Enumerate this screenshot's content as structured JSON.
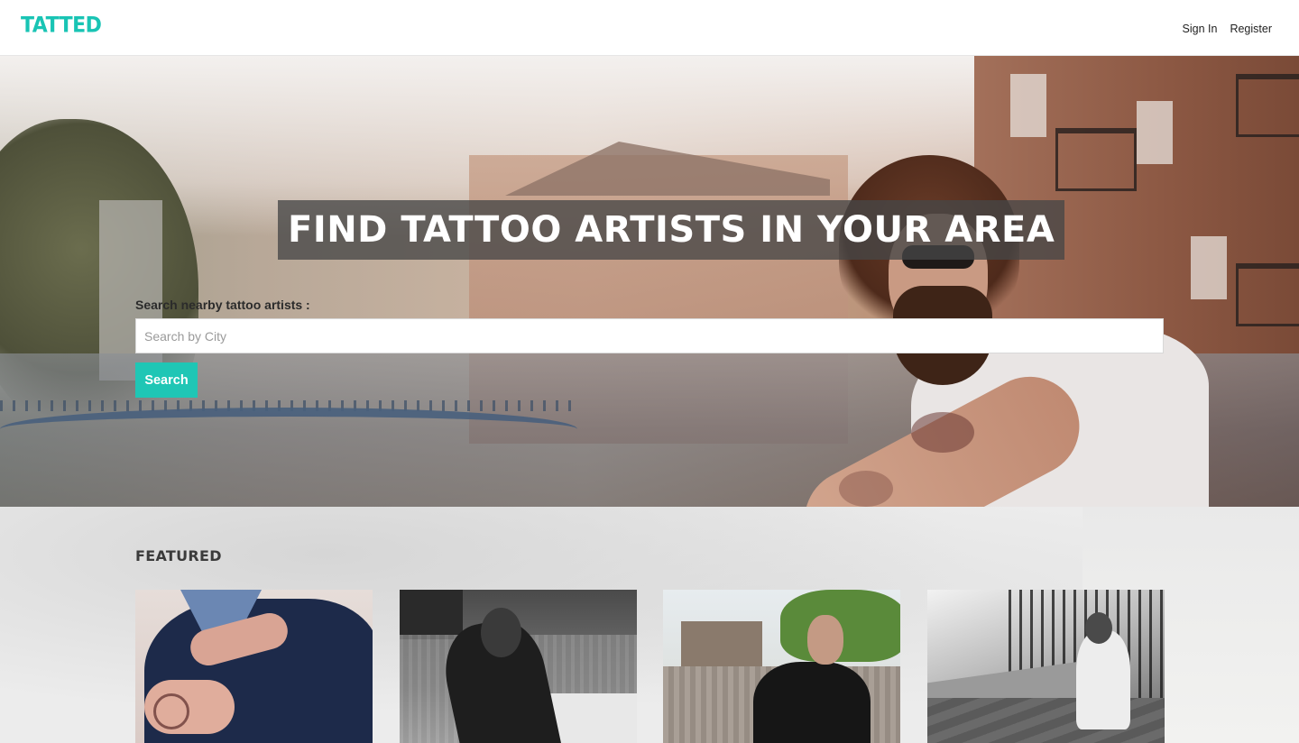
{
  "header": {
    "logo": "TATTED",
    "nav": [
      {
        "label": "Sign In"
      },
      {
        "label": "Register"
      }
    ]
  },
  "hero": {
    "title": "FIND TATTOO ARTISTS IN YOUR AREA",
    "search_label": "Search nearby tattoo artists :",
    "search_placeholder": "Search by City",
    "search_value": "",
    "search_button": "Search"
  },
  "featured": {
    "heading": "FEATURED",
    "cards": [
      {
        "image": "man-in-suit-tattooed-hands"
      },
      {
        "image": "bearded-man-in-diner-bw"
      },
      {
        "image": "man-in-leather-jacket-outdoors"
      },
      {
        "image": "tattooed-man-sitting-street-bw"
      }
    ]
  },
  "colors": {
    "accent": "#1fc6b5",
    "logo": "#19c4b4",
    "title_overlay": "#464646"
  }
}
